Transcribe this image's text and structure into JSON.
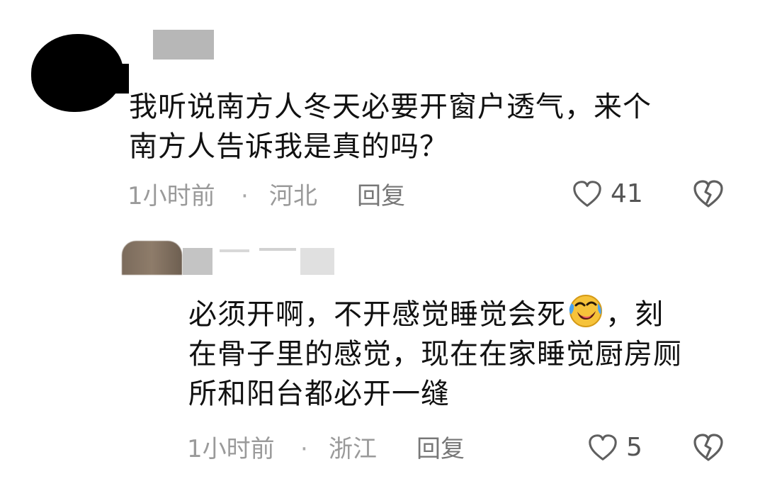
{
  "comments": [
    {
      "text_lines": [
        "我听说南方人冬天必要开窗户透气，来个",
        "南方人告诉我是真的吗？"
      ],
      "time": "1小时前",
      "separator": "·",
      "location": "河北",
      "reply_label": "回复",
      "likes": "41",
      "icons": {
        "like": "heart-outline-icon",
        "dislike": "broken-heart-icon"
      }
    },
    {
      "text_lines": [
        "必须开啊，不开感觉睡觉会死",
        "，刻",
        "在骨子里的感觉，现在在家睡觉厨房厕",
        "所和阳台都必开一缝"
      ],
      "emoji": "rolling-on-the-floor-laughing-emoji",
      "time": "1小时前",
      "separator": "·",
      "location": "浙江",
      "reply_label": "回复",
      "likes": "5",
      "icons": {
        "like": "heart-outline-icon",
        "dislike": "broken-heart-icon"
      }
    }
  ],
  "colors": {
    "text": "#111111",
    "meta": "#9a9a9a",
    "icon": "#666666",
    "emoji_face": "#f6c33a",
    "emoji_tear": "#4aa3f0"
  }
}
